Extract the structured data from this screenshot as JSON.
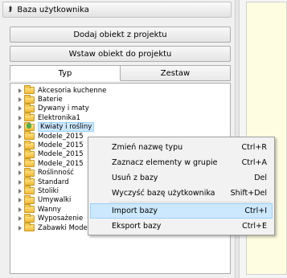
{
  "panel": {
    "title": "Baza użytkownika",
    "add_from_project": "Dodaj obiekt z projektu",
    "insert_to_project": "Wstaw obiekt do projektu",
    "tabs": [
      "Typ",
      "Zestaw"
    ]
  },
  "tree": {
    "items": [
      "Akcesoria kuchenne",
      "Baterie",
      "Dywany i maty",
      "Elektronika1",
      "Kwiaty i rośliny",
      "Modele_2015",
      "Modele_2015",
      "Modele_2015",
      "Modele_2015",
      "Roślinność",
      "Standard",
      "Stoliki",
      "Umywalki",
      "Wanny",
      "Wyposażenie",
      "Zabawki Modele Gadżety"
    ],
    "selected_index": 4
  },
  "context_menu": {
    "items": [
      {
        "label": "Zmień nazwę typu",
        "shortcut": "Ctrl+R"
      },
      {
        "label": "Zaznacz elementy w grupie",
        "shortcut": "Ctrl+A"
      },
      {
        "label": "Usuń z bazy",
        "shortcut": "Del"
      },
      {
        "label": "Wyczyść bazę użytkownika",
        "shortcut": "Shift+Del"
      },
      {
        "label": "Import bazy",
        "shortcut": "Ctrl+I"
      },
      {
        "label": "Eksport bazy",
        "shortcut": "Ctrl+E"
      }
    ],
    "highlight_index": 4
  }
}
